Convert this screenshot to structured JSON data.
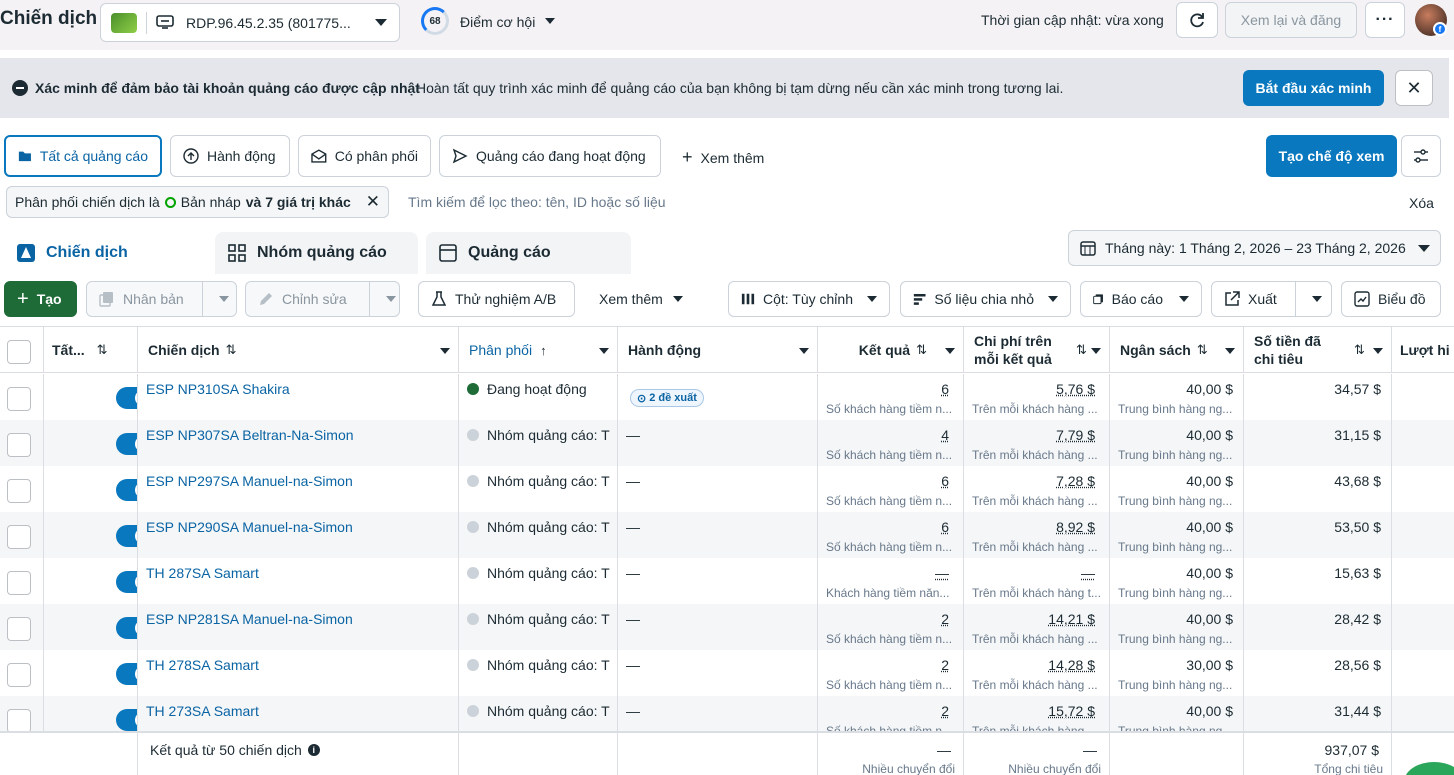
{
  "header": {
    "title": "Chiến dịch",
    "account_name": "RDP.96.45.2.35 (801775...",
    "score_value": "68",
    "score_label": "Điểm cơ hội",
    "updated_text": "Thời gian cập nhật: vừa xong",
    "review_publish_label": "Xem lại và đăng",
    "more_label": "···"
  },
  "banner": {
    "title": "Xác minh để đảm bảo tài khoản quảng cáo được cập nhật",
    "description": "Hoàn tất quy trình xác minh để quảng cáo của bạn không bị tạm dừng nếu cần xác minh trong tương lai.",
    "cta_label": "Bắt đầu xác minh",
    "close_label": "✕"
  },
  "filters": {
    "tabs": [
      "Tất cả quảng cáo",
      "Hành động",
      "Có phân phối",
      "Quảng cáo đang hoạt động"
    ],
    "more_label": "Xem thêm",
    "create_view_label": "Tạo chế độ xem"
  },
  "search": {
    "chip_prefix": "Phân phối chiến dịch là",
    "chip_value": "Bản nháp",
    "chip_suffix": "và 7 giá trị khác",
    "placeholder": "Tìm kiếm để lọc theo: tên, ID hoặc số liệu",
    "clear_label": "Xóa"
  },
  "level_tabs": [
    "Chiến dịch",
    "Nhóm quảng cáo",
    "Quảng cáo"
  ],
  "date_range": "Tháng này: 1 Tháng 2, 2026 – 23 Tháng 2, 2026",
  "toolbar": {
    "create": "Tạo",
    "duplicate": "Nhân bản",
    "edit": "Chỉnh sửa",
    "ab_test": "Thử nghiệm A/B",
    "more": "Xem thêm",
    "columns": "Cột: Tùy chỉnh",
    "breakdown": "Số liệu chia nhỏ",
    "reports": "Báo cáo",
    "export": "Xuất",
    "charts": "Biểu đồ"
  },
  "table": {
    "headers": {
      "toggle": "Tất...",
      "campaign": "Chiến dịch",
      "delivery": "Phân phối",
      "actions": "Hành động",
      "results": "Kết quả",
      "cost_per_result": "Chi phí trên mỗi kết quả",
      "budget": "Ngân sách",
      "amount_spent": "Số tiền đã chi tiêu",
      "reach": "Lượt hi"
    },
    "rows": [
      {
        "name": "ESP NP310SA Shakira",
        "delivery": "Đang hoạt động",
        "active": true,
        "action": "",
        "suggestion": "2 đề xuất",
        "results": "6",
        "results_sub": "Số khách hàng tiềm n...",
        "cpr": "5,76 $",
        "cpr_sub": "Trên mỗi khách hàng ...",
        "budget": "40,00 $",
        "budget_sub": "Trung bình hàng ng...",
        "spent": "34,57 $"
      },
      {
        "name": "ESP NP307SA Beltran-Na-Simon",
        "delivery": "Nhóm quảng cáo: T",
        "active": false,
        "action": "—",
        "suggestion": "",
        "results": "4",
        "results_sub": "Số khách hàng tiềm n...",
        "cpr": "7,79 $",
        "cpr_sub": "Trên mỗi khách hàng ...",
        "budget": "40,00 $",
        "budget_sub": "Trung bình hàng ng...",
        "spent": "31,15 $"
      },
      {
        "name": "ESP NP297SA Manuel-na-Simon",
        "delivery": "Nhóm quảng cáo: T",
        "active": false,
        "action": "—",
        "suggestion": "",
        "results": "6",
        "results_sub": "Số khách hàng tiềm n...",
        "cpr": "7,28 $",
        "cpr_sub": "Trên mỗi khách hàng ...",
        "budget": "40,00 $",
        "budget_sub": "Trung bình hàng ng...",
        "spent": "43,68 $"
      },
      {
        "name": "ESP NP290SA Manuel-na-Simon",
        "delivery": "Nhóm quảng cáo: T",
        "active": false,
        "action": "—",
        "suggestion": "",
        "results": "6",
        "results_sub": "Số khách hàng tiềm n...",
        "cpr": "8,92 $",
        "cpr_sub": "Trên mỗi khách hàng ...",
        "budget": "40,00 $",
        "budget_sub": "Trung bình hàng ng...",
        "spent": "53,50 $"
      },
      {
        "name": "TH 287SA Samart",
        "delivery": "Nhóm quảng cáo: T",
        "active": false,
        "action": "—",
        "suggestion": "",
        "results": "—",
        "results_sub": "Khách hàng tiềm năn...",
        "cpr": "—",
        "cpr_sub": "Trên mỗi khách hàng t...",
        "budget": "40,00 $",
        "budget_sub": "Trung bình hàng ng...",
        "spent": "15,63 $"
      },
      {
        "name": "ESP NP281SA Manuel-na-Simon",
        "delivery": "Nhóm quảng cáo: T",
        "active": false,
        "action": "—",
        "suggestion": "",
        "results": "2",
        "results_sub": "Số khách hàng tiềm n...",
        "cpr": "14,21 $",
        "cpr_sub": "Trên mỗi khách hàng ...",
        "budget": "40,00 $",
        "budget_sub": "Trung bình hàng ng...",
        "spent": "28,42 $"
      },
      {
        "name": "TH 278SA Samart",
        "delivery": "Nhóm quảng cáo: T",
        "active": false,
        "action": "—",
        "suggestion": "",
        "results": "2",
        "results_sub": "Số khách hàng tiềm n...",
        "cpr": "14,28 $",
        "cpr_sub": "Trên mỗi khách hàng ...",
        "budget": "30,00 $",
        "budget_sub": "Trung bình hàng ng...",
        "spent": "28,56 $"
      },
      {
        "name": "TH 273SA Samart",
        "delivery": "Nhóm quảng cáo: T",
        "active": false,
        "action": "—",
        "suggestion": "",
        "results": "2",
        "results_sub": "Số khách hàng tiềm n...",
        "cpr": "15,72 $",
        "cpr_sub": "Trên mỗi khách hàng ...",
        "budget": "40,00 $",
        "budget_sub": "Trung bình hàng ng...",
        "spent": "31,44 $"
      }
    ],
    "footer": {
      "label": "Kết quả từ 50 chiến dịch",
      "results": "—",
      "results_sub": "Nhiều chuyển đổi",
      "cpr": "—",
      "cpr_sub": "Nhiều chuyển đổi",
      "spent": "937,07 $",
      "spent_sub": "Tổng chi tiêu"
    }
  },
  "colors": {
    "accent": "#0a78be",
    "link": "#0a64a4",
    "create_green": "#1e6b37",
    "status_active": "#1e6b37"
  }
}
